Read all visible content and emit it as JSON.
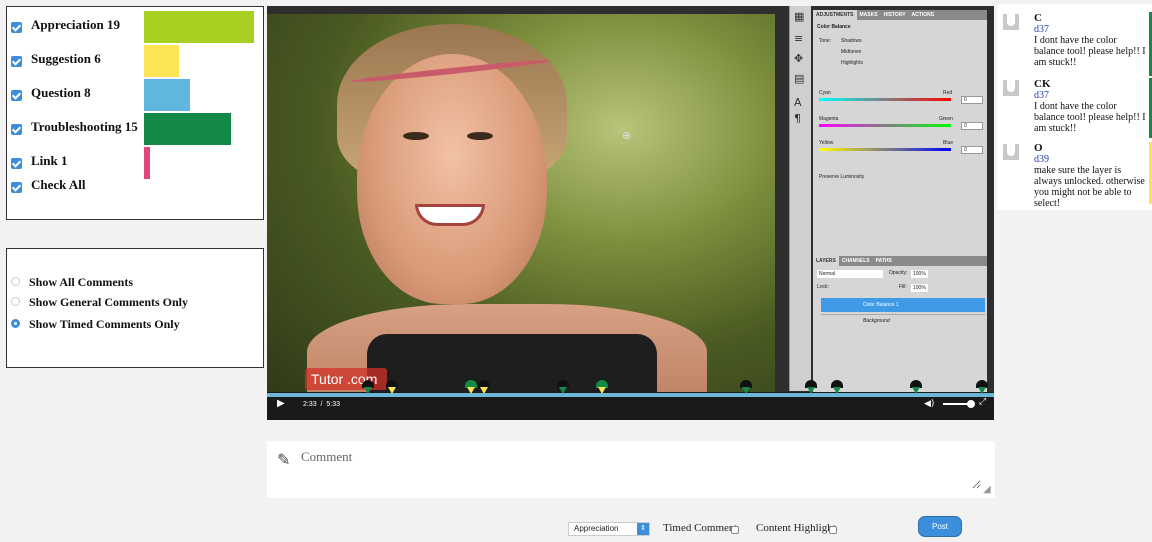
{
  "filters": {
    "items": [
      {
        "label": "Appreciation 19",
        "value": 19,
        "color": "#a7cf21"
      },
      {
        "label": "Suggestion 6",
        "value": 6,
        "color": "#fde455"
      },
      {
        "label": "Question 8",
        "value": 8,
        "color": "#5fb6de"
      },
      {
        "label": "Troubleshooting 15",
        "value": 15,
        "color": "#148a49"
      },
      {
        "label": "Link 1",
        "value": 1,
        "color": "#e0457b"
      }
    ],
    "check_all": "Check All"
  },
  "modes": {
    "options": [
      "Show All Comments",
      "Show General Comments Only",
      "Show Timed Comments Only"
    ],
    "selected": "Show Timed Comments Only"
  },
  "video": {
    "time_current": "2:33",
    "time_separator": "/",
    "time_total": "5:33",
    "watermark": "Tutor   .com",
    "progress_fraction": 0.46,
    "markers": [
      {
        "category": "Appreciation",
        "top": "#111111",
        "tri": "#148a49"
      },
      {
        "category": "Suggestion",
        "top": "#111111",
        "tri": "#fde455"
      },
      {
        "category": "Troubleshooting",
        "top": "#148a49",
        "tri": "#fde455"
      },
      {
        "category": "Suggestion",
        "top": "#111111",
        "tri": "#fde455"
      },
      {
        "category": "Appreciation",
        "top": "#111111",
        "tri": "#148a49"
      },
      {
        "category": "Suggestion",
        "top": "#148a49",
        "tri": "#fde455"
      },
      {
        "category": "Appreciation",
        "top": "#111111",
        "tri": "#148a49"
      },
      {
        "category": "Appreciation",
        "top": "#111111",
        "tri": "#148a49"
      },
      {
        "category": "Appreciation",
        "top": "#111111",
        "tri": "#148a49"
      },
      {
        "category": "Appreciation",
        "top": "#111111",
        "tri": "#148a49"
      },
      {
        "category": "Appreciation",
        "top": "#111111",
        "tri": "#148a49"
      }
    ],
    "photoshop": {
      "tabs": [
        "ADJUSTMENTS",
        "MASKS",
        "HISTORY",
        "ACTIONS"
      ],
      "panel_title": "Color Balance",
      "tone_label": "Tone:",
      "tones": [
        "Shadows",
        "Midtones",
        "Highlights"
      ],
      "sliders": [
        {
          "left": "Cyan",
          "right": "Red",
          "value": "0"
        },
        {
          "left": "Magenta",
          "right": "Green",
          "value": "0"
        },
        {
          "left": "Yellow",
          "right": "Blue",
          "value": "0"
        }
      ],
      "preserve": "Preserve Luminosity",
      "layer_tabs": [
        "LAYERS",
        "CHANNELS",
        "PATHS"
      ],
      "blend_mode": "Normal",
      "opacity_label": "Opacity:",
      "opacity": "100%",
      "lock_label": "Lock:",
      "fill_label": "Fill:",
      "fill": "100%",
      "layers": [
        "Color Balance 1",
        "Background"
      ]
    }
  },
  "comments": [
    {
      "name": "C",
      "user": "d37",
      "text": "I dont have the color balance tool! please help!! I am stuck!!",
      "color": "#148a49"
    },
    {
      "name": "CK",
      "user": "d37",
      "text": "I dont have the color balance tool! please help!! I am stuck!!",
      "color": "#148a49"
    },
    {
      "name": "O",
      "user": "d39",
      "text": "make sure the layer is always unlocked. otherwise you might not be able to select!",
      "color": "#fde455"
    }
  ],
  "composer": {
    "placeholder": "Comment",
    "type_selected": "Appreciation",
    "timed_label": "Timed Comment",
    "highlight_label": "Content Highlight",
    "post_label": "Post"
  }
}
